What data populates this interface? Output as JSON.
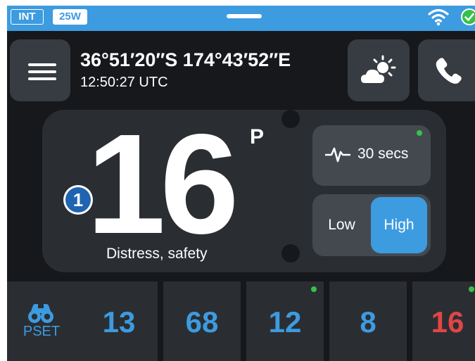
{
  "status_bar": {
    "mode_badge": "INT",
    "power_badge": "25W",
    "icons": [
      "wifi-icon",
      "check-circle-icon"
    ]
  },
  "header": {
    "menu_icon": "hamburger-menu-icon",
    "coordinates": "36°51′20″S  174°43′52″E",
    "time": "12:50:27 UTC",
    "weather_icon": "weather-sun-cloud-icon",
    "phone_icon": "phone-icon"
  },
  "channel": {
    "number": "16",
    "suffix": "P",
    "description": "Distress, safety",
    "callout": "1"
  },
  "scan": {
    "icon": "pulse-icon",
    "label": "30 secs",
    "active": true
  },
  "power": {
    "low_label": "Low",
    "high_label": "High",
    "selected": "High"
  },
  "channel_strip": {
    "pset_label": "PSET",
    "pset_icon": "binoculars-icon",
    "tiles": [
      {
        "number": "13",
        "dot": false,
        "alert": false
      },
      {
        "number": "68",
        "dot": false,
        "alert": false
      },
      {
        "number": "12",
        "dot": true,
        "alert": false
      },
      {
        "number": "8",
        "dot": false,
        "alert": false
      },
      {
        "number": "16",
        "dot": true,
        "alert": true
      }
    ]
  },
  "colors": {
    "accent_blue": "#3d9be0",
    "alert_red": "#e24545",
    "active_green": "#35c24a",
    "background": "#16181b",
    "panel": "#2a2e33"
  }
}
